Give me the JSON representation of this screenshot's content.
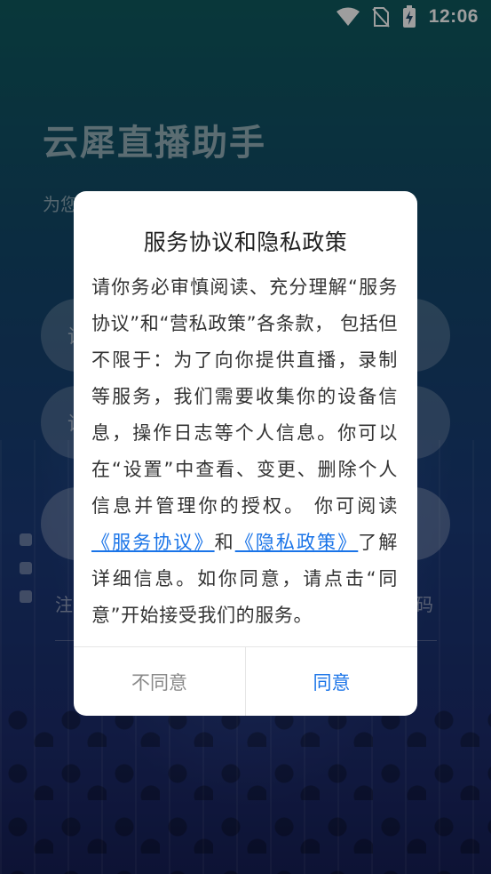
{
  "status_bar": {
    "time": "12:06",
    "icons": [
      "wifi-icon",
      "no-sim-icon",
      "battery-charging-icon"
    ]
  },
  "background": {
    "app_title": "云犀直播助手",
    "subtitle": "为您",
    "field1_placeholder": "请",
    "field2_placeholder": "请",
    "bottom_left_text": "注",
    "bottom_right_text": "码"
  },
  "dialog": {
    "title": "服务协议和隐私政策",
    "body_part1": "请你务必审慎阅读、充分理解“服务协议”和“营私政策”各条款， 包括但不限于：为了向你提供直播，录制等服务，我们需要收集你的设备信息，操作日志等个人信息。你可以在“设置”中查看、变更、删除个人信息并管理你的授权。 你可阅读",
    "link_service": "《服务协议》",
    "body_and": "和",
    "link_privacy": "《隐私政策》",
    "body_part2": "了解详细信息。如你同意，请点击“同意”开始接受我们的服务。",
    "disagree_label": "不同意",
    "agree_label": "同意"
  },
  "colors": {
    "link": "#1a74e8",
    "accent": "#1a74e8"
  }
}
